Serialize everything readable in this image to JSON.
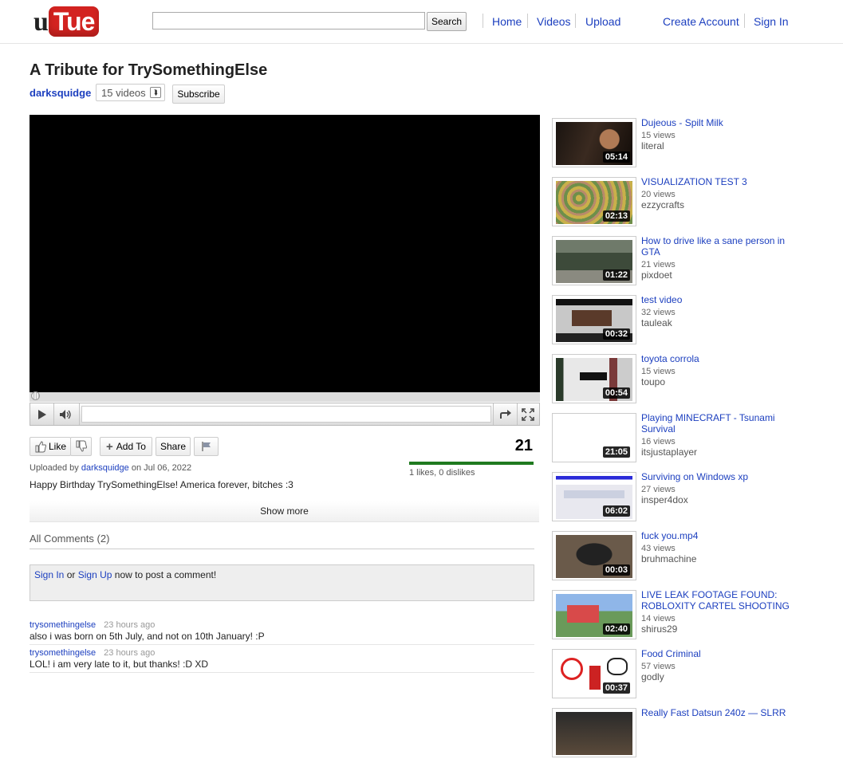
{
  "header": {
    "logo_u": "u",
    "logo_tube": "Tue",
    "search": {
      "value": "",
      "placeholder": "",
      "button": "Search"
    },
    "nav": [
      "Home",
      "Videos",
      "Upload"
    ],
    "account": [
      "Create Account",
      "Sign In"
    ]
  },
  "video": {
    "title": "A Tribute for TrySomethingElse",
    "channel": "darksquidge",
    "videos_count": "15 videos",
    "subscribe": "Subscribe",
    "views": "21",
    "likes_text": "1 likes, 0 dislikes",
    "like_label": "Like",
    "add_to_label": "Add To",
    "share_label": "Share",
    "uploaded_prefix": "Uploaded by",
    "uploaded_user": "darksquidge",
    "uploaded_on": "on Jul 06, 2022",
    "description": "Happy Birthday TrySomethingElse! America forever, bitches :3",
    "show_more": "Show more"
  },
  "comments": {
    "header": "All Comments (2)",
    "sign_in": "Sign In",
    "or": "or",
    "sign_up": "Sign Up",
    "post_suffix": "now to post a comment!",
    "items": [
      {
        "author": "trysomethingelse",
        "time": "23 hours ago",
        "text": "also i was born on 5th July, and not on 10th January! :P"
      },
      {
        "author": "trysomethingelse",
        "time": "23 hours ago",
        "text": "LOL! i am very late to it, but thanks! :D XD"
      }
    ]
  },
  "sidebar": [
    {
      "title": "Dujeous - Spilt Milk",
      "views": "15 views",
      "author": "literal",
      "duration": "05:14"
    },
    {
      "title": "VISUALIZATION TEST 3",
      "views": "20 views",
      "author": "ezzycrafts",
      "duration": "02:13"
    },
    {
      "title": "How to drive like a sane person in GTA",
      "views": "21 views",
      "author": "pixdoet",
      "duration": "01:22"
    },
    {
      "title": "test video",
      "views": "32 views",
      "author": "tauleak",
      "duration": "00:32"
    },
    {
      "title": "toyota corrola",
      "views": "15 views",
      "author": "toupo",
      "duration": "00:54"
    },
    {
      "title": "Playing MINECRAFT - Tsunami Survival",
      "views": "16 views",
      "author": "itsjustaplayer",
      "duration": "21:05"
    },
    {
      "title": "Surviving on Windows xp",
      "views": "27 views",
      "author": "insper4dox",
      "duration": "06:02"
    },
    {
      "title": "fuck you.mp4",
      "views": "43 views",
      "author": "bruhmachine",
      "duration": "00:03"
    },
    {
      "title": "LIVE LEAK FOOTAGE FOUND: ROBLOXITY CARTEL SHOOTING",
      "views": "14 views",
      "author": "shirus29",
      "duration": "02:40"
    },
    {
      "title": "Food Criminal",
      "views": "57 views",
      "author": "godly",
      "duration": "00:37"
    },
    {
      "title": "Really Fast Datsun 240z — SLRR",
      "views": "",
      "author": "",
      "duration": ""
    }
  ],
  "like_ratio": 1.0,
  "colors": {
    "link": "#1c3fbf",
    "logo_red": "#d32320",
    "like_bar": "#1f7a1f"
  }
}
